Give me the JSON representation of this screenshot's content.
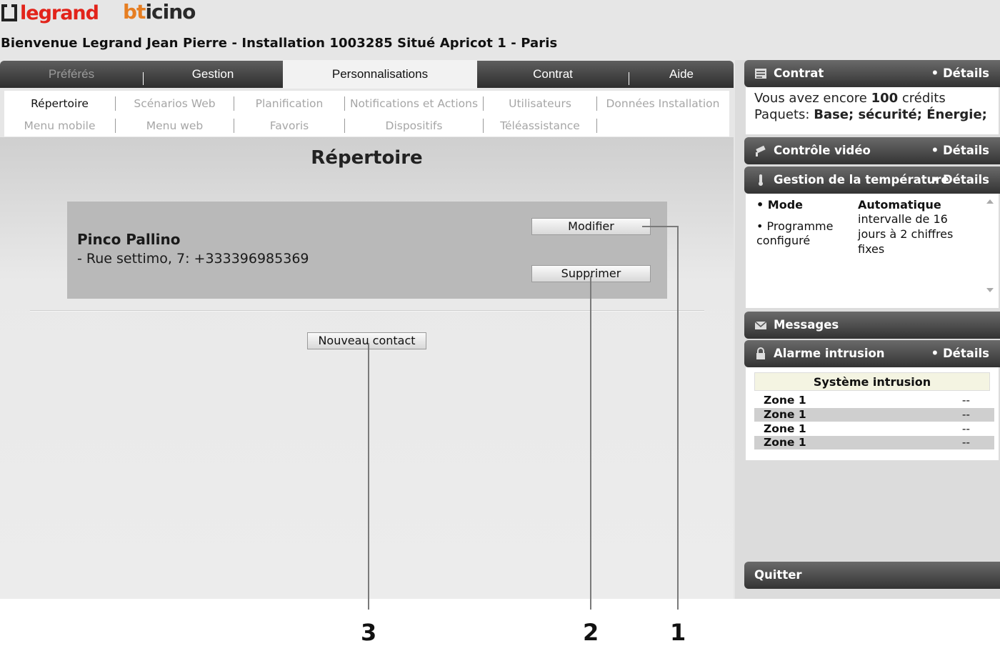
{
  "brand": {
    "legrand": "legrand",
    "bticino_b": "bt",
    "bticino_rest": "icino",
    "legrand_color": "#e2231a",
    "bticino_color": "#e67e22"
  },
  "welcome": "Bienvenue Legrand Jean Pierre - Installation 1003285 Situé Apricot 1 - Paris",
  "main_tabs": [
    {
      "label": "Préférés",
      "state": "disabled"
    },
    {
      "label": "Gestion",
      "state": "normal"
    },
    {
      "label": "Personnalisations",
      "state": "active"
    },
    {
      "label": "Contrat",
      "state": "normal"
    },
    {
      "label": "Aide",
      "state": "normal"
    }
  ],
  "sub_nav": {
    "row1": [
      "Répertoire",
      "Scénarios Web",
      "Planification",
      "Notifications et Actions",
      "Utilisateurs",
      "Données Installation"
    ],
    "row2": [
      "Menu mobile",
      "Menu web",
      "Favoris",
      "Dispositifs",
      "Téléassistance"
    ],
    "active": "Répertoire"
  },
  "page_title": "Répertoire",
  "contact": {
    "name": "Pinco Pallino",
    "detail": "- Rue settimo, 7: +333396985369",
    "modify_label": "Modifier",
    "delete_label": "Supprimer"
  },
  "new_contact_label": "Nouveau contact",
  "callouts": [
    "1",
    "2",
    "3"
  ],
  "sidebar": {
    "contract": {
      "title": "Contrat",
      "details": "• Détails",
      "line1_prefix": "Vous avez encore ",
      "line1_credits": "100",
      "line1_suffix": " crédits",
      "line2_prefix": "Paquets: ",
      "line2_packages": "Base; sécurité; Énergie;"
    },
    "video": {
      "title": "Contrôle vidéo",
      "details": "•  Détails"
    },
    "temperature": {
      "title": "Gestion de la température",
      "details": "• Détails",
      "mode_label": "• Mode",
      "mode_value": "Automatique",
      "program_label_1": "• Programme",
      "program_label_2": "configuré",
      "program_value_1": "intervalle de 16",
      "program_value_2": "jours à 2 chiffres",
      "program_value_3": "fixes"
    },
    "messages": {
      "title": "Messages"
    },
    "intrusion": {
      "title": "Alarme intrusion",
      "details": "• Détails",
      "system_title": "Système intrusion",
      "zones": [
        {
          "name": "Zone 1",
          "value": "--"
        },
        {
          "name": "Zone 1",
          "value": "--"
        },
        {
          "name": "Zone 1",
          "value": "--"
        },
        {
          "name": "Zone 1",
          "value": "--"
        }
      ]
    },
    "quit_label": "Quitter"
  }
}
